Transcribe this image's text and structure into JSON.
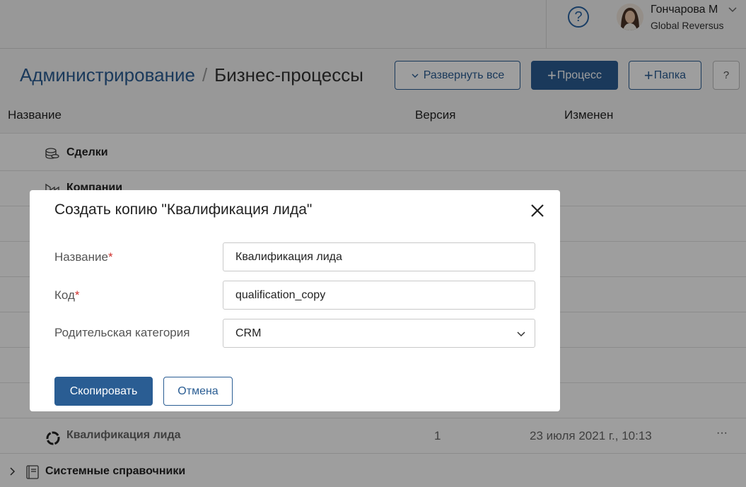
{
  "header": {
    "help_symbol": "?",
    "user_name": "Гончарова М",
    "company": "Global Reversus"
  },
  "breadcrumb": {
    "root": "Администрирование",
    "separator": "/",
    "current": "Бизнес-процессы"
  },
  "toolbar": {
    "expand_all": "Развернуть все",
    "add_process": "Процесс",
    "add_folder": "Папка",
    "help": "?"
  },
  "table": {
    "columns": [
      "Название",
      "Версия",
      "Изменен"
    ],
    "rows": [
      {
        "name": "Сделки",
        "icon": "coins-stack-icon"
      },
      {
        "name": "Компании",
        "icon": "buildings-icon"
      },
      {
        "name": "Квалификация лида",
        "icon": "process-circle-icon",
        "version": "1",
        "modified": "23 июля 2021 г., 10:13",
        "menu": "···"
      },
      {
        "name": "Системные справочники",
        "icon": "book-icon"
      }
    ]
  },
  "modal": {
    "title": "Создать копию \"Квалификация лида\"",
    "fields": {
      "name_label": "Название",
      "name_value": "Квалификация лида",
      "code_label": "Код",
      "code_value": "qualification_copy",
      "parent_label": "Родительская категория",
      "parent_value": "CRM",
      "required_mark": "*"
    },
    "copy_button": "Скопировать",
    "cancel_button": "Отмена"
  },
  "colors": {
    "accent": "#2a5d93",
    "required": "#d0312d"
  }
}
